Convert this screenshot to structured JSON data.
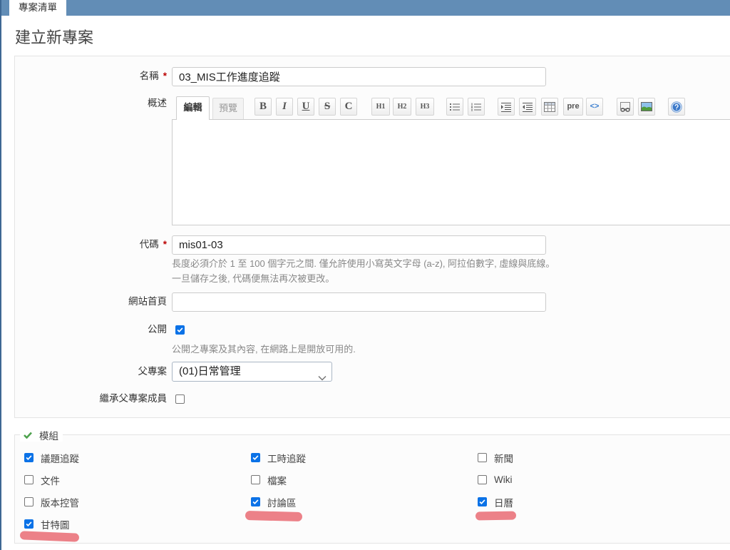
{
  "colors": {
    "top_bar": "#628db6",
    "required_mark": "#bb0000",
    "checkbox_checked": "#0b72e7",
    "hint_text": "#888888",
    "annotation_mark": "#ea737b",
    "module_legend_check": "#4ea24e"
  },
  "top_bar": {
    "tab_label": "專案清單"
  },
  "page_title": "建立新專案",
  "form": {
    "name": {
      "label": "名稱",
      "required_mark": "*",
      "value": "03_MIS工作進度追蹤"
    },
    "description": {
      "label": "概述",
      "tab_edit": "編輯",
      "tab_preview": "預覽",
      "toolbar": {
        "bold": "B",
        "italic": "I",
        "underline": "U",
        "strikethrough": "S",
        "inline_code": "C",
        "heading_1": "H1",
        "heading_2": "H2",
        "heading_3": "H3",
        "pre": "pre",
        "highlighted_code": "<>",
        "icons": [
          "unordered-list-icon",
          "ordered-list-icon",
          "blockquote-icon",
          "unblockquote-icon",
          "table-icon",
          "wiki-link-icon",
          "image-icon",
          "help-icon"
        ]
      },
      "value": ""
    },
    "identifier": {
      "label": "代碼",
      "required_mark": "*",
      "value": "mis01-03",
      "hint_1": "長度必須介於 1 至 100 個字元之間. 僅允許使用小寫英文字母 (a-z), 阿拉伯數字, 虛線與底線。",
      "hint_2": "一旦儲存之後, 代碼便無法再次被更改。"
    },
    "homepage": {
      "label": "網站首頁",
      "value": ""
    },
    "is_public": {
      "label": "公開",
      "checked": true,
      "hint": "公開之專案及其內容, 在網路上是開放可用的."
    },
    "parent_project": {
      "label": "父專案",
      "selected": "(01)日常管理"
    },
    "inherit_members": {
      "label": "繼承父專案成員",
      "checked": false
    }
  },
  "modules": {
    "legend": "模組",
    "items": [
      {
        "label": "議題追蹤",
        "checked": true
      },
      {
        "label": "工時追蹤",
        "checked": true
      },
      {
        "label": "新聞",
        "checked": false
      },
      {
        "label": "文件",
        "checked": false
      },
      {
        "label": "檔案",
        "checked": false
      },
      {
        "label": "Wiki",
        "checked": false
      },
      {
        "label": "版本控管",
        "checked": false
      },
      {
        "label": "討論區",
        "checked": true
      },
      {
        "label": "日曆",
        "checked": true
      },
      {
        "label": "甘特圖",
        "checked": true
      }
    ]
  }
}
